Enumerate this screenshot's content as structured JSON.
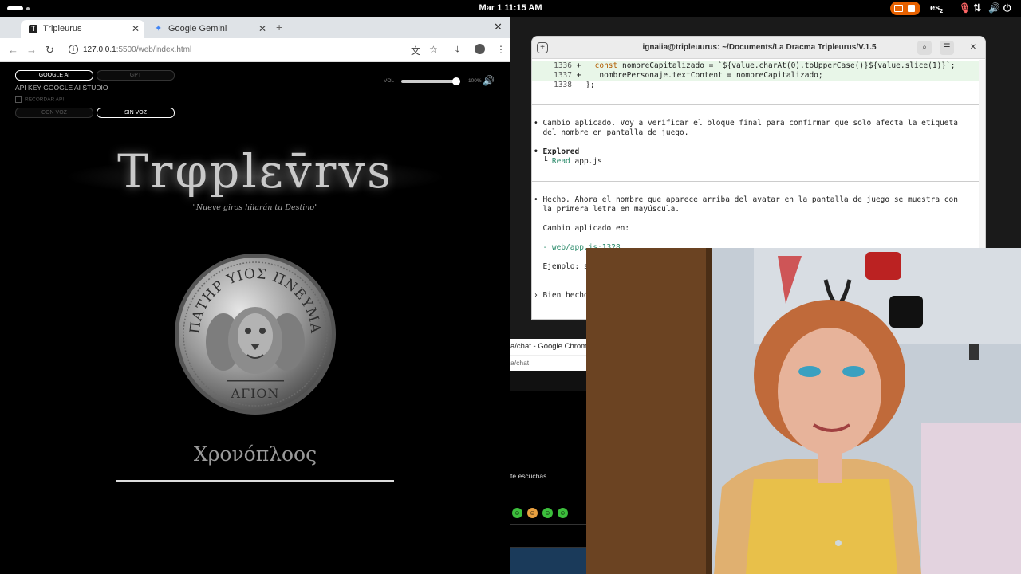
{
  "topbar": {
    "clock": "Mar 1  11:15 AM",
    "keyboard_layout": "es",
    "keyboard_layout_sub": "2"
  },
  "browser": {
    "tabs": [
      {
        "label": "Tripleurus",
        "icon": "T"
      },
      {
        "label": "Google Gemini",
        "icon": "gemini-icon"
      }
    ],
    "url_host": "127.0.0.1",
    "url_rest": ":5500/web/index.html"
  },
  "page": {
    "provider_buttons": [
      "GOOGLE AI",
      "GPT"
    ],
    "api_key_label": "API KEY GOOGLE AI STUDIO",
    "remember_label": "RECORDAR API",
    "voice_buttons": [
      "CON VOZ",
      "SIN VOZ"
    ],
    "volume_label": "VOL",
    "volume_percent": "100%",
    "volume_level": 1.0,
    "logo_title": "Trφplεv̄rvs",
    "tagline": "\"Nueve giros hilarán tu Destino\"",
    "coin_top_text": "ΠΑΤΗΡ ΥΙΟΣ ΠΝΕΥΜΑ",
    "coin_bottom_text": "ΑΓΙΟΝ",
    "character_name": "Χρονόπλοος"
  },
  "terminal": {
    "title": "ignaiia@tripleuurus: ~/Documents/La Dracma Tripleurus/V.1.5",
    "diff_lines": [
      {
        "num": "1336",
        "mark": "+",
        "code_kw": "const",
        "code_rest": " nombreCapitalizado = `${value.charAt(0).toUpperCase()}${value.slice(1)}`;"
      },
      {
        "num": "1337",
        "mark": "+",
        "code_kw": "",
        "code_rest": " nombrePersonaje.textContent = nombreCapitalizado;"
      },
      {
        "num": "1338",
        "mark": " ",
        "code_kw": "",
        "code_rest": "};"
      }
    ],
    "message1_line1": "• Cambio aplicado. Voy a verificar el bloque final para confirmar que solo afecta la etiqueta",
    "message1_line2": "  del nombre en pantalla de juego.",
    "explored_label": "• Explored",
    "explored_item_verb": "Read",
    "explored_item_file": "app.js",
    "message2_line1": "• Hecho. Ahora el nombre que aparece arriba del avatar en la pantalla de juego se muestra con",
    "message2_line2": "  la primera letra en mayúscula.",
    "changes_label": "  Cambio aplicado en:",
    "change_file": "  - web/app.js:1328",
    "example_label": "  Ejemplo: s",
    "prompt_text": "› Bien hecho"
  },
  "bg_window": {
    "title_fragment": "a/chat - Google Chrome",
    "url_fragment": "a/chat",
    "listen_text": "te escuchas"
  },
  "colors": {
    "record_indicator": "#e66100",
    "accent_green": "#2a8a6a",
    "diff_add_bg": "#e8f6e8"
  }
}
